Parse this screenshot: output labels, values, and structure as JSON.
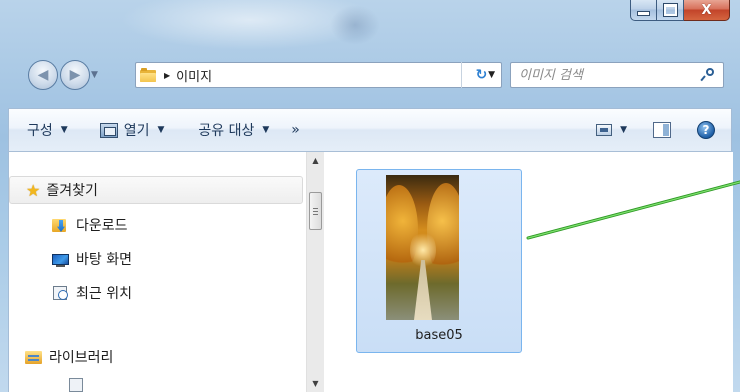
{
  "window": {
    "caption_buttons": {
      "minimize_icon": "minimize-icon",
      "maximize_icon": "maximize-icon",
      "close_icon": "close-icon",
      "close_glyph": "X"
    }
  },
  "nav": {
    "back_glyph": "◀",
    "forward_glyph": "▶",
    "dropdown_glyph": "▼"
  },
  "address": {
    "separator": "▶",
    "crumb": "이미지",
    "dropdown_glyph": "▼",
    "refresh_glyph": "↻"
  },
  "search": {
    "placeholder": "이미지 검색"
  },
  "toolbar": {
    "organize": "구성",
    "open": "열기",
    "share": "공유 대상",
    "more": "»",
    "arrow": "▼"
  },
  "sidebar": {
    "favorites": "즐겨찾기",
    "items": [
      {
        "label": "다운로드",
        "icon": "download-folder-icon"
      },
      {
        "label": "바탕 화면",
        "icon": "desktop-icon"
      },
      {
        "label": "최근 위치",
        "icon": "recent-places-icon"
      }
    ],
    "libraries": "라이브러리"
  },
  "scrollbar": {
    "up_glyph": "▲",
    "down_glyph": "▼"
  },
  "files": [
    {
      "name": "base05",
      "selected": true
    }
  ],
  "colors": {
    "selection_border": "#7ab5ee",
    "selection_fill": "#cfe2f8",
    "annotation_line": "#3dbb2f",
    "close_button": "#c2442a"
  }
}
